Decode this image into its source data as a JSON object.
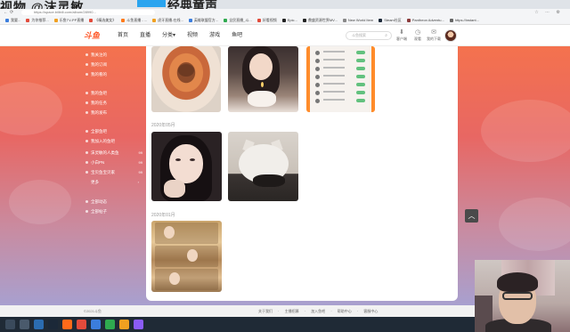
{
  "overlay": {
    "left_title": "视物 @沫灵敏",
    "badge": "",
    "right_title": "经典童声"
  },
  "browser": {
    "url": "https://space.bilibili.com/album/28990...",
    "bookmarks": [
      {
        "label": "我要...",
        "color": "#3b7ddd"
      },
      {
        "label": "为你推荐...",
        "color": "#e24b3b"
      },
      {
        "label": "乐鱼TV-PP直播",
        "color": "#f0a020"
      },
      {
        "label": "《精选美女》",
        "color": "#e24b3b"
      },
      {
        "label": "斗鱼直播 - ...",
        "color": "#ff7a1a"
      },
      {
        "label": "虎牙直播-在线...",
        "color": "#f0a020"
      },
      {
        "label": "英雄联盟官方...",
        "color": "#3b7ddd"
      },
      {
        "label": "全民直播_斗...",
        "color": "#2faa4f"
      },
      {
        "label": "好看视频",
        "color": "#e24b3b"
      },
      {
        "label": "Epic...",
        "color": "#222222"
      },
      {
        "label": "鼎盛资源世界MV...",
        "color": "#222222"
      },
      {
        "label": "New World Item",
        "color": "#888888"
      },
      {
        "label": "Steam社区",
        "color": "#1b2838"
      },
      {
        "label": "Pantheon Adventu...",
        "color": "#8b3b3b"
      },
      {
        "label": "https://instant...",
        "color": "#666666"
      }
    ]
  },
  "header": {
    "logo": "斗鱼",
    "nav": [
      "首页",
      "直播",
      "分类▾",
      "视频",
      "游戏",
      "鱼吧"
    ],
    "search_placeholder": "斗鱼搜索",
    "icons": [
      {
        "label": "客户端",
        "glyph": "⬇"
      },
      {
        "label": "观看",
        "glyph": "◷"
      },
      {
        "label": "我的下载",
        "glyph": "✉"
      }
    ]
  },
  "sidebar": {
    "items": [
      {
        "label": "我关注的",
        "count": ""
      },
      {
        "label": "我的订阅",
        "count": ""
      },
      {
        "label": "我的看的",
        "count": ""
      },
      {
        "label": "我的鱼吧",
        "count": ""
      },
      {
        "label": "我的任务",
        "count": ""
      },
      {
        "label": "我的发布",
        "count": ""
      },
      {
        "label": "全部鱼吧",
        "count": ""
      },
      {
        "label": "我加入的鱼吧",
        "count": ""
      },
      {
        "label": "沫灵敏的人类鱼",
        "count": "99"
      },
      {
        "label": "小白PN",
        "count": "99"
      },
      {
        "label": "宝贝鱼宝贝家",
        "count": "99"
      },
      {
        "label": "更多",
        "count": ""
      },
      {
        "label": "全部动态",
        "count": ""
      },
      {
        "label": "全部帖子",
        "count": ""
      }
    ]
  },
  "main": {
    "sections": [
      {
        "date": "2020年05月"
      },
      {
        "date": "2020年01月"
      }
    ]
  },
  "footer": {
    "copyright": "©2021斗鱼",
    "links": [
      "关于我们",
      "·",
      "主播招募",
      "·",
      "加入鱼吧",
      "·",
      "帮助中心",
      "·",
      "客服中心"
    ]
  },
  "scroll_top": "︿"
}
